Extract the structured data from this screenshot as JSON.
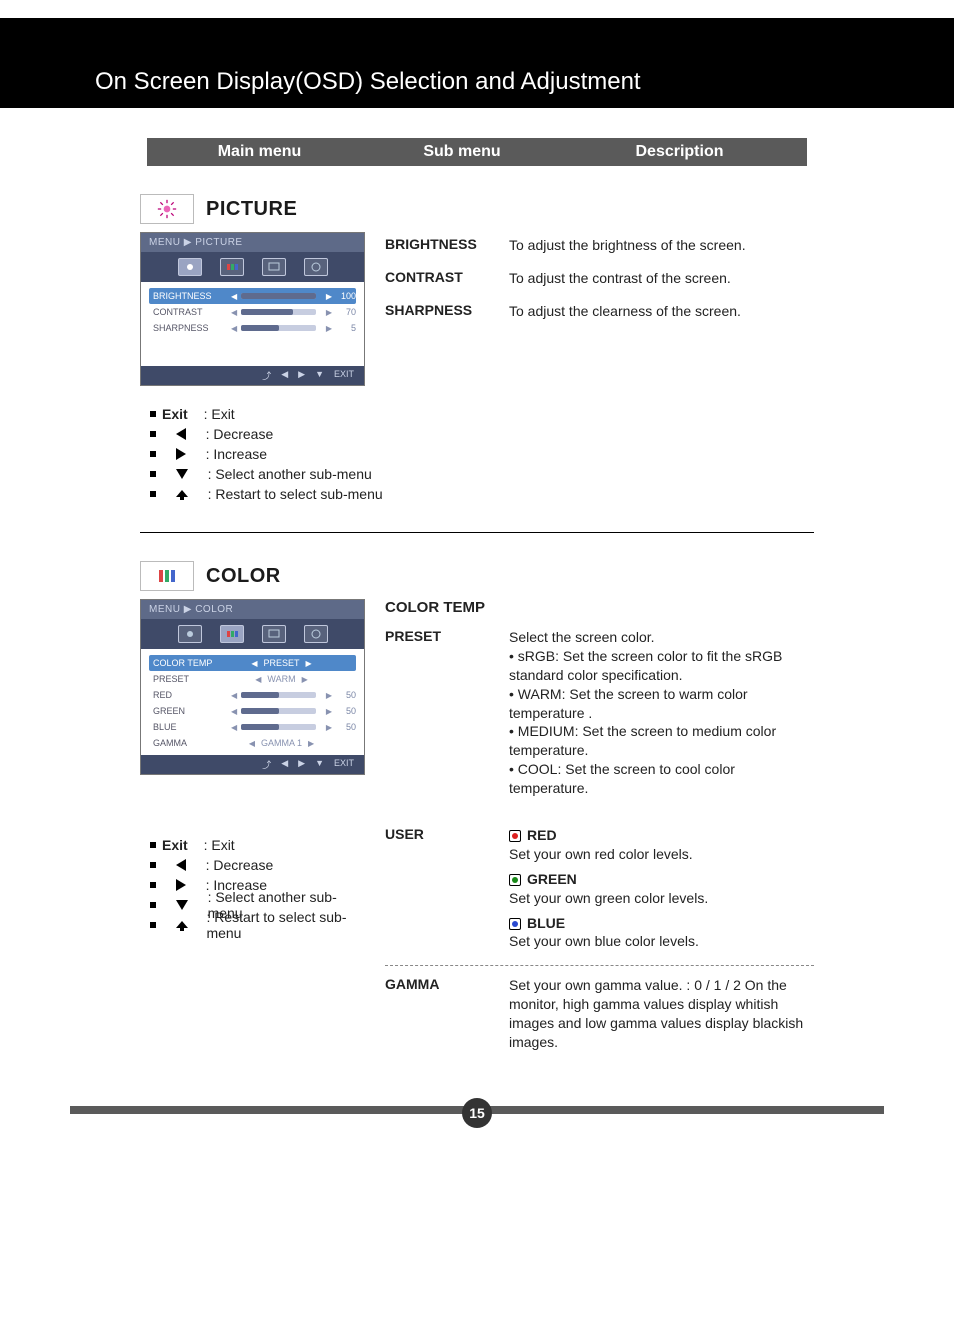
{
  "header": {
    "title": "On Screen Display(OSD) Selection and Adjustment"
  },
  "menubar": {
    "main": "Main menu",
    "sub": "Sub menu",
    "desc": "Description"
  },
  "picture": {
    "title": "PICTURE",
    "osd": {
      "breadcrumb": "MENU ▶ PICTURE",
      "items": [
        {
          "label": "BRIGHTNESS",
          "value": "100",
          "fill": 100
        },
        {
          "label": "CONTRAST",
          "value": "70",
          "fill": 70
        },
        {
          "label": "SHARPNESS",
          "value": "5",
          "fill": 50
        }
      ],
      "nav": [
        "⭠",
        "◀",
        "▶",
        "▼",
        "EXIT"
      ]
    },
    "subs": [
      {
        "name": "BRIGHTNESS",
        "desc": "To adjust the brightness of the screen."
      },
      {
        "name": "CONTRAST",
        "desc": "To adjust the contrast of the screen."
      },
      {
        "name": "SHARPNESS",
        "desc": "To adjust the clearness of the screen."
      }
    ]
  },
  "legend": {
    "exit_label": "Exit",
    "exit_desc": ": Exit",
    "left": ": Decrease",
    "right": ": Increase",
    "down": ": Select another sub-menu",
    "up": ": Restart to select sub-menu"
  },
  "color": {
    "title": "COLOR",
    "osd": {
      "breadcrumb": "MENU ▶ COLOR",
      "items": [
        {
          "label": "COLOR TEMP",
          "select": "PRESET"
        },
        {
          "label": "PRESET",
          "select": "WARM"
        },
        {
          "label": "RED",
          "value": "50",
          "fill": 50
        },
        {
          "label": "GREEN",
          "value": "50",
          "fill": 50
        },
        {
          "label": "BLUE",
          "value": "50",
          "fill": 50
        },
        {
          "label": "GAMMA",
          "select": "GAMMA 1"
        }
      ],
      "nav": [
        "⭠",
        "◀",
        "▶",
        "▼",
        "EXIT"
      ]
    },
    "heading": "COLOR TEMP",
    "preset": {
      "name": "PRESET",
      "intro": "Select the screen color.",
      "opts": [
        {
          "head": "• sRGB:",
          "txt": "Set the screen color to fit the sRGB standard color specification."
        },
        {
          "head": "• WARM:",
          "txt": "Set the screen to warm color temperature ."
        },
        {
          "head": "• MEDIUM:",
          "txt": "Set the screen to medium color temperature."
        },
        {
          "head": "• COOL:",
          "txt": "Set the screen to cool color temperature."
        }
      ]
    },
    "user": {
      "name": "USER",
      "red": {
        "label": "RED",
        "desc": "Set your own red color levels."
      },
      "green": {
        "label": "GREEN",
        "desc": "Set your own green color levels."
      },
      "blue": {
        "label": "BLUE",
        "desc": "Set your own blue color levels."
      }
    },
    "gamma": {
      "name": "GAMMA",
      "desc": "Set your own gamma value. : 0 / 1 / 2 On the monitor, high gamma values display whitish images and low gamma values display blackish images."
    }
  },
  "page_number": "15"
}
